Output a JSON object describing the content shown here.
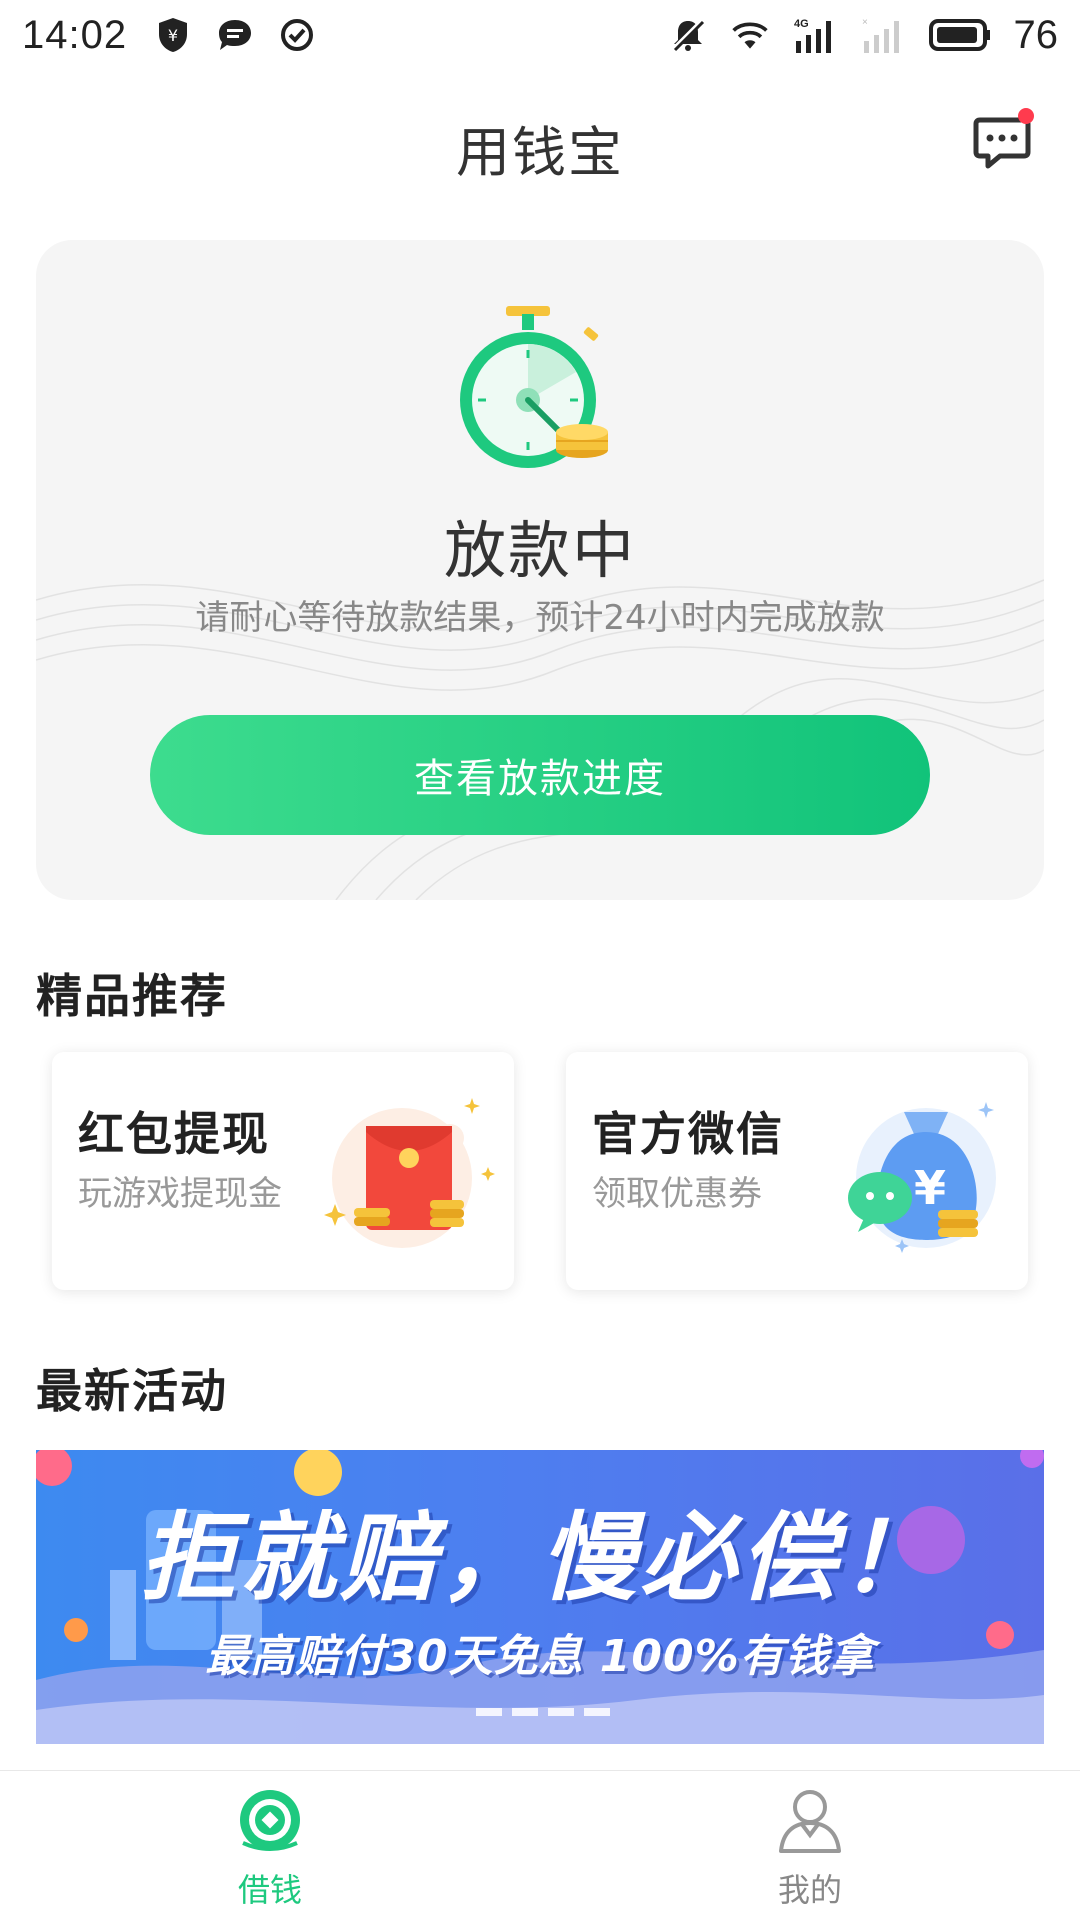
{
  "status_bar": {
    "time": "14:02",
    "battery": "76",
    "network": "4G"
  },
  "header": {
    "title": "用钱宝"
  },
  "loan_status": {
    "title": "放款中",
    "description": "请耐心等待放款结果，预计24小时内完成放款",
    "button_label": "查看放款进度"
  },
  "recommend": {
    "section_title": "精品推荐",
    "cards": [
      {
        "title": "红包提现",
        "subtitle": "玩游戏提现金",
        "icon": "red-envelope-icon"
      },
      {
        "title": "官方微信",
        "subtitle": "领取优惠券",
        "icon": "money-bag-wechat-icon"
      }
    ]
  },
  "activities": {
    "section_title": "最新活动",
    "banner_headline": "拒就赔，慢必偿！",
    "banner_sub": "最高赔付30天免息 100%有钱拿",
    "page_count": 4
  },
  "tabs": [
    {
      "label": "借钱",
      "icon": "loan-coin-icon",
      "active": true
    },
    {
      "label": "我的",
      "icon": "user-icon",
      "active": false
    }
  ],
  "colors": {
    "accent": "#1ec97f",
    "tab_active": "#1ec97f",
    "tab_inactive": "#888888",
    "badge": "#ff3b4e"
  }
}
